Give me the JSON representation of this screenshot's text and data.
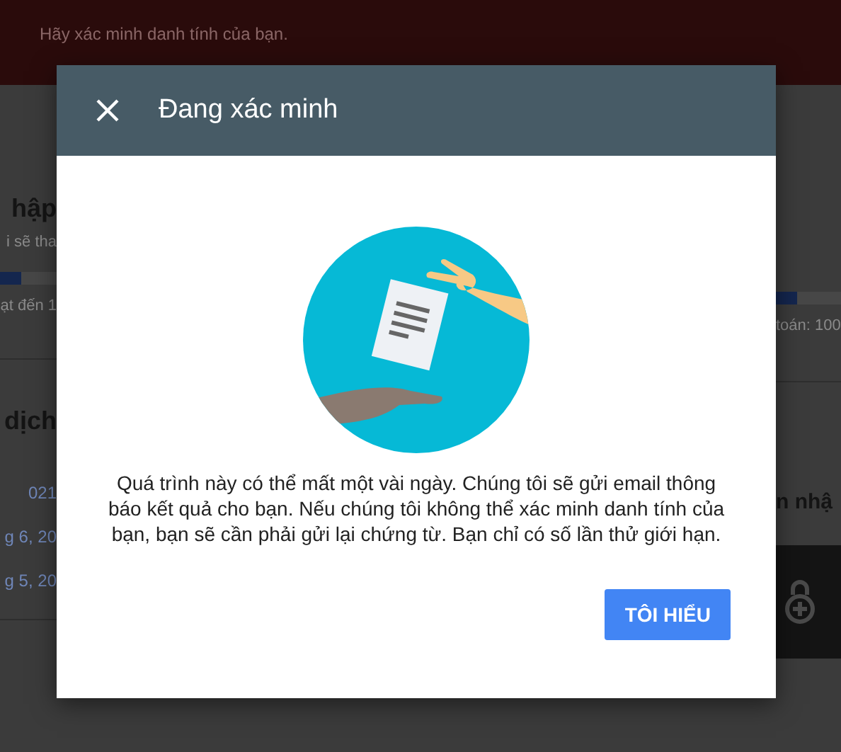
{
  "banner": {
    "text": "Hãy xác minh danh tính của bạn."
  },
  "background_left": [
    {
      "kind": "heading",
      "text": "hập"
    },
    {
      "kind": "note",
      "text": "i sẽ tha"
    },
    {
      "kind": "bar"
    },
    {
      "kind": "note",
      "text": "ạt đến 1"
    },
    {
      "kind": "rule"
    },
    {
      "kind": "heading",
      "text": "dịch"
    },
    {
      "kind": "link",
      "text": "021"
    },
    {
      "kind": "link",
      "text": "g 6, 20"
    },
    {
      "kind": "link",
      "text": "g 5, 20"
    },
    {
      "kind": "rule"
    }
  ],
  "background_right": [
    {
      "kind": "bar"
    },
    {
      "kind": "note",
      "text": "toán: 100"
    },
    {
      "kind": "rule"
    },
    {
      "kind": "heading",
      "text": "n nhậ"
    },
    {
      "kind": "panel"
    }
  ],
  "dialog": {
    "title": "Đang xác minh",
    "message": "Quá trình này có thể mất một vài ngày. Chúng tôi sẽ gửi email thông báo kết quả cho bạn. Nếu chúng tôi không thể xác minh danh tính của bạn, bạn sẽ cần phải gửi lại chứng từ. Bạn chỉ có số lần thử giới hạn.",
    "button": "TÔI HIỂU"
  }
}
